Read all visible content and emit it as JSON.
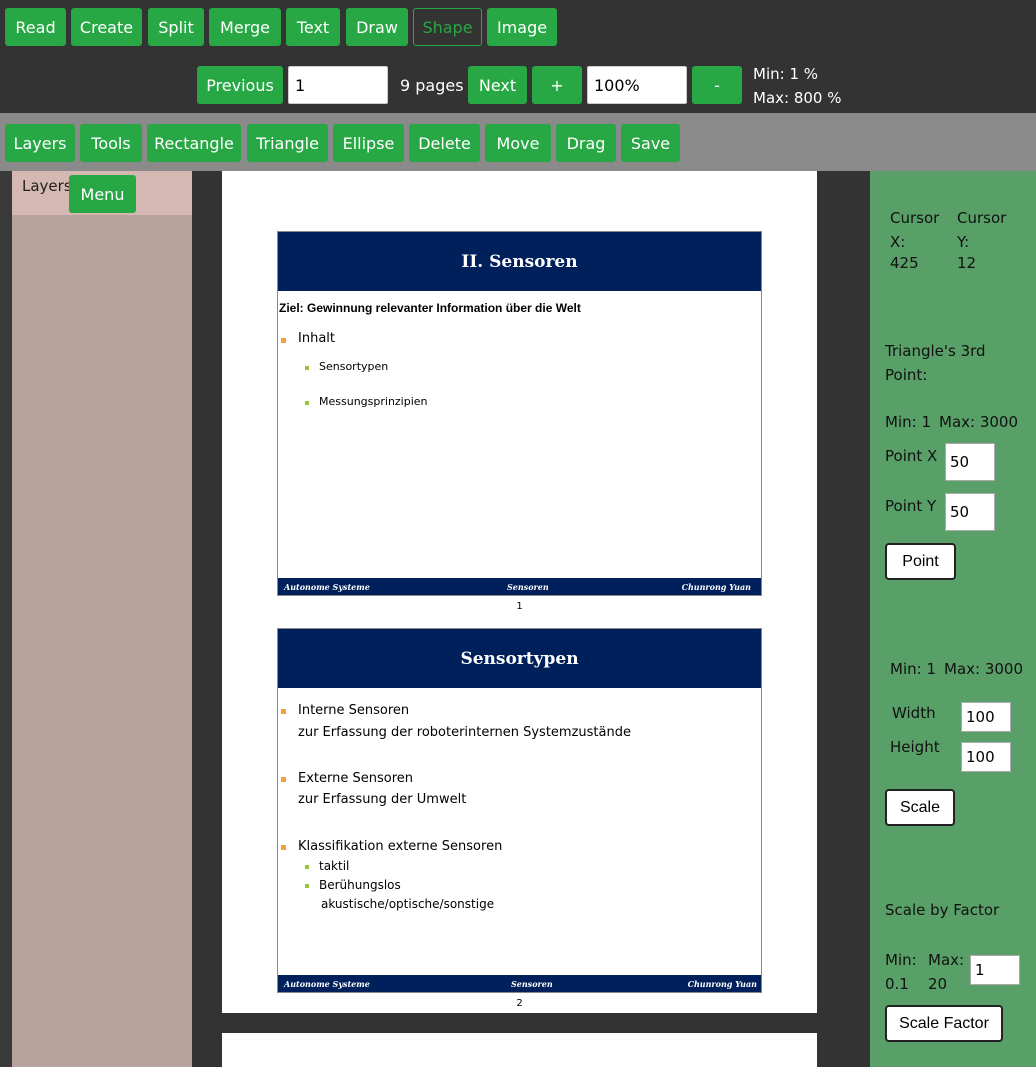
{
  "toolbar_top": {
    "read": "Read",
    "create": "Create",
    "split": "Split",
    "merge": "Merge",
    "text": "Text",
    "draw": "Draw",
    "shape": "Shape",
    "image": "Image"
  },
  "nav": {
    "previous": "Previous",
    "page_value": "1",
    "pages": "9 pages",
    "next": "Next",
    "zoom_in": "+",
    "zoom_value": "100%",
    "zoom_out": "-",
    "min": "Min: 1 %",
    "max": "Max: 800 %"
  },
  "toolbar_shape": {
    "layers": "Layers",
    "tools": "Tools",
    "rectangle": "Rectangle",
    "triangle": "Triangle",
    "ellipse": "Ellipse",
    "delete": "Delete",
    "move": "Move",
    "drag": "Drag",
    "save": "Save"
  },
  "left_panel": {
    "title": "Layers",
    "menu": "Menu"
  },
  "slide1": {
    "title": "II. Sensoren",
    "goal": "Ziel: Gewinnung relevanter Information über die Welt",
    "bullet1": "Inhalt",
    "sub1": "Sensortypen",
    "sub2": "Messungsprinzipien",
    "footer_left": "Autonome Systeme",
    "footer_mid": "Sensoren",
    "footer_right": "Chunrong Yuan",
    "page_number": "1"
  },
  "slide2": {
    "title": "Sensortypen",
    "b1": "Interne Sensoren",
    "b1_line2": "zur Erfassung der roboterinternen Systemzustände",
    "b2": "Externe Sensoren",
    "b2_line2": "zur Erfassung der Umwelt",
    "b3": "Klassifikation externe Sensoren",
    "sub1": "taktil",
    "sub2": "Berühungslos",
    "sub2_line2": "akustische/optische/sonstige",
    "footer_left": "Autonome Systeme",
    "footer_mid": "Sensoren",
    "footer_right": "Chunrong Yuan",
    "page_number": "2"
  },
  "right_panel": {
    "cursor_x_label": "Cursor X:",
    "cursor_x_value": "425",
    "cursor_y_label": "Cursor Y:",
    "cursor_y_value": "12",
    "triangle_heading": "Triangle's 3rd Point:",
    "tri_min": "Min: 1",
    "tri_max": "Max: 3000",
    "point_x_label": "Point X",
    "point_x_value": "50",
    "point_y_label": "Point Y",
    "point_y_value": "50",
    "point_button": "Point",
    "scale_min": "Min: 1",
    "scale_max": "Max: 3000",
    "width_label": "Width",
    "width_value": "100",
    "height_label": "Height",
    "height_value": "100",
    "scale_button": "Scale",
    "factor_heading": "Scale by Factor",
    "factor_min_label": "Min:",
    "factor_min_value": "0.1",
    "factor_max_label": "Max:",
    "factor_max_value": "20",
    "factor_value": "1",
    "factor_button": "Scale Factor"
  }
}
